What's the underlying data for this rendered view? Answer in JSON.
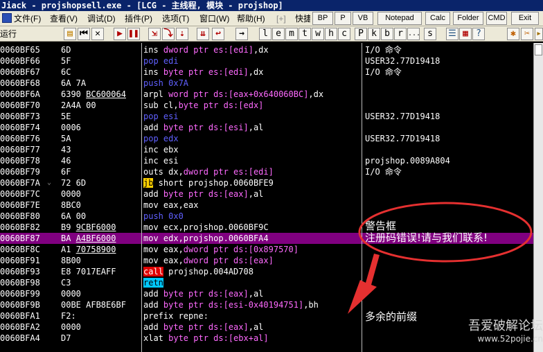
{
  "titlebar": {
    "text": "Jiack   - projshopsell.exe - [LCG - 主线程, 模块 - projshop]"
  },
  "menubar": {
    "items": [
      "文件(F)",
      "查看(V)",
      "调试(D)",
      "插件(P)",
      "选项(T)",
      "窗口(W)",
      "帮助(H)",
      "[+]",
      "快捷菜单"
    ],
    "buttons": [
      "BP",
      "P",
      "VB",
      "Notepad",
      "Calc",
      "Folder",
      "CMD",
      "Exit"
    ]
  },
  "toolbar": {
    "status": "运行",
    "letters": [
      "l",
      "e",
      "m",
      "t",
      "w",
      "h",
      "c",
      "P",
      "k",
      "b",
      "r",
      "...",
      "s"
    ]
  },
  "rows": [
    {
      "addr": "0060BF65",
      "hex": "6D",
      "ins": [
        [
          "mn",
          "ins "
        ],
        [
          "t",
          "dword ptr es:[edi]"
        ],
        [
          "p",
          ",dx"
        ]
      ],
      "c": "I/O 命令"
    },
    {
      "addr": "0060BF66",
      "hex": "5F",
      "ins": [
        [
          "push",
          "pop edi"
        ]
      ],
      "c": "USER32.77D19418"
    },
    {
      "addr": "0060BF67",
      "hex": "6C",
      "ins": [
        [
          "mn",
          "ins "
        ],
        [
          "t",
          "byte ptr es:[edi]"
        ],
        [
          "p",
          ",dx"
        ]
      ],
      "c": "I/O 命令"
    },
    {
      "addr": "0060BF68",
      "hex": "6A 7A",
      "ins": [
        [
          "push",
          "push 0x7A"
        ]
      ],
      "c": ""
    },
    {
      "addr": "0060BF6A",
      "hex": "6390 BC600064",
      "hexu": "BC600064",
      "ins": [
        [
          "mn",
          "arpl "
        ],
        [
          "t",
          "word ptr ds:[eax+0x640060BC]"
        ],
        [
          "p",
          ",dx"
        ]
      ],
      "c": ""
    },
    {
      "addr": "0060BF70",
      "hex": "2A4A 00",
      "ins": [
        [
          "mn",
          "sub cl,"
        ],
        [
          "t",
          "byte ptr ds:[edx]"
        ]
      ],
      "c": ""
    },
    {
      "addr": "0060BF73",
      "hex": "5E",
      "ins": [
        [
          "push",
          "pop esi"
        ]
      ],
      "c": "USER32.77D19418"
    },
    {
      "addr": "0060BF74",
      "hex": "0006",
      "ins": [
        [
          "mn",
          "add "
        ],
        [
          "t",
          "byte ptr ds:[esi]"
        ],
        [
          "p",
          ",al"
        ]
      ],
      "c": ""
    },
    {
      "addr": "0060BF76",
      "hex": "5A",
      "ins": [
        [
          "push",
          "pop edx"
        ]
      ],
      "c": "USER32.77D19418"
    },
    {
      "addr": "0060BF77",
      "hex": "43",
      "ins": [
        [
          "mn",
          "inc ebx"
        ]
      ],
      "c": ""
    },
    {
      "addr": "0060BF78",
      "hex": "46",
      "ins": [
        [
          "mn",
          "inc esi"
        ]
      ],
      "c": "projshop.0089A804"
    },
    {
      "addr": "0060BF79",
      "hex": "6F",
      "ins": [
        [
          "mn",
          "outs dx,"
        ],
        [
          "t",
          "dword ptr es:[edi]"
        ]
      ],
      "c": "I/O 命令"
    },
    {
      "addr": "0060BF7A",
      "hex": "72 6D",
      "ins": [
        [
          "jcc",
          "jb"
        ],
        [
          "mn",
          " short projshop.0060BFE9"
        ]
      ],
      "c": ""
    },
    {
      "addr": "0060BF7C",
      "hex": "0000",
      "ins": [
        [
          "mn",
          "add "
        ],
        [
          "t",
          "byte ptr ds:[eax]"
        ],
        [
          "p",
          ",al"
        ]
      ],
      "c": ""
    },
    {
      "addr": "0060BF7E",
      "hex": "8BC0",
      "ins": [
        [
          "mn",
          "mov eax,eax"
        ]
      ],
      "c": ""
    },
    {
      "addr": "0060BF80",
      "hex": "6A 00",
      "ins": [
        [
          "push",
          "push 0x0"
        ]
      ],
      "c": ""
    },
    {
      "addr": "0060BF82",
      "hex": "B9 9CBF6000",
      "ins": [
        [
          "mn",
          "mov ecx,projshop.0060BF9C"
        ]
      ],
      "c": ""
    },
    {
      "addr": "0060BF87",
      "hex": "BA A4BF6000",
      "ins": [
        [
          "mn",
          "mov edx,projshop.0060BFA4"
        ]
      ],
      "c": ""
    },
    {
      "addr": "0060BF8C",
      "hex": "A1 70758900",
      "ins": [
        [
          "mn",
          "mov eax,"
        ],
        [
          "t",
          "dword ptr ds:[0x897570]"
        ]
      ],
      "c": ""
    },
    {
      "addr": "0060BF91",
      "hex": "8B00",
      "ins": [
        [
          "mn",
          "mov eax,"
        ],
        [
          "t",
          "dword ptr ds:[eax]"
        ]
      ],
      "c": ""
    },
    {
      "addr": "0060BF93",
      "hex": "E8 7017EAFF",
      "ins": [
        [
          "call",
          "call"
        ],
        [
          "mn",
          " projshop.004AD708"
        ]
      ],
      "c": ""
    },
    {
      "addr": "0060BF98",
      "hex": "C3",
      "ins": [
        [
          "retn",
          "retn"
        ]
      ],
      "c": ""
    },
    {
      "addr": "0060BF99",
      "hex": "0000",
      "ins": [
        [
          "mn",
          "add "
        ],
        [
          "t",
          "byte ptr ds:[eax]"
        ],
        [
          "p",
          ",al"
        ]
      ],
      "c": ""
    },
    {
      "addr": "0060BF9B",
      "hex": "00BE AFB8E6BF",
      "ins": [
        [
          "mn",
          "add "
        ],
        [
          "t",
          "byte ptr ds:[esi-0x40194751]"
        ],
        [
          "p",
          ",bh"
        ]
      ],
      "c": ""
    },
    {
      "addr": "0060BFA1",
      "hex": "F2:",
      "ins": [
        [
          "mn",
          "prefix repne:"
        ]
      ],
      "c": ""
    },
    {
      "addr": "0060BFA2",
      "hex": "0000",
      "ins": [
        [
          "mn",
          "add "
        ],
        [
          "t",
          "byte ptr ds:[eax]"
        ],
        [
          "p",
          ",al"
        ]
      ],
      "c": ""
    },
    {
      "addr": "0060BFA4",
      "hex": "D7",
      "ins": [
        [
          "mn",
          "xlat "
        ],
        [
          "t",
          "byte ptr ds:[ebx+al]"
        ]
      ],
      "c": ""
    }
  ],
  "annotations": {
    "title": "警告框",
    "message": "注册码错误!请与我们联系!",
    "note": "多余的前缀"
  },
  "watermark": {
    "line1": "吾爱破解论坛",
    "line2": "www.52pojie.cn"
  }
}
